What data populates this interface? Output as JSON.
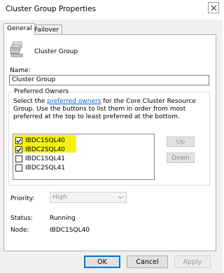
{
  "window": {
    "title": "Cluster Group Properties"
  },
  "tabs": [
    {
      "label": "General"
    },
    {
      "label": "Failover"
    }
  ],
  "group": {
    "name": "Cluster Group",
    "icon": "cluster-resource-icon"
  },
  "name_field": {
    "label": "Name:",
    "value": "Cluster Group"
  },
  "preferred_owners": {
    "legend": "Preferred Owners",
    "desc_before": "Select the ",
    "desc_link": "preferred owners",
    "desc_after": " for the Core Cluster Resource Group. Use the buttons to list them in order from most preferred at the top to least preferred at the bottom.",
    "owners": [
      {
        "label": "IBDC1SQL40",
        "checked": true,
        "highlighted": true
      },
      {
        "label": "IBDC2SQL40",
        "checked": true,
        "highlighted": true
      },
      {
        "label": "IBDC1SQL41",
        "checked": false,
        "highlighted": false
      },
      {
        "label": "IBDC2SQL41",
        "checked": false,
        "highlighted": false
      }
    ],
    "up_label": "Up",
    "down_label": "Down"
  },
  "priority": {
    "label": "Priority:",
    "value": "High"
  },
  "status": {
    "label": "Status:",
    "value": "Running"
  },
  "node": {
    "label": "Node:",
    "value": "IBDC1SQL40"
  },
  "buttons": {
    "ok": "OK",
    "cancel": "Cancel",
    "apply": "Apply"
  },
  "colors": {
    "highlight": "#f4f20f",
    "link": "#0066cc",
    "focus": "#0078d7"
  }
}
